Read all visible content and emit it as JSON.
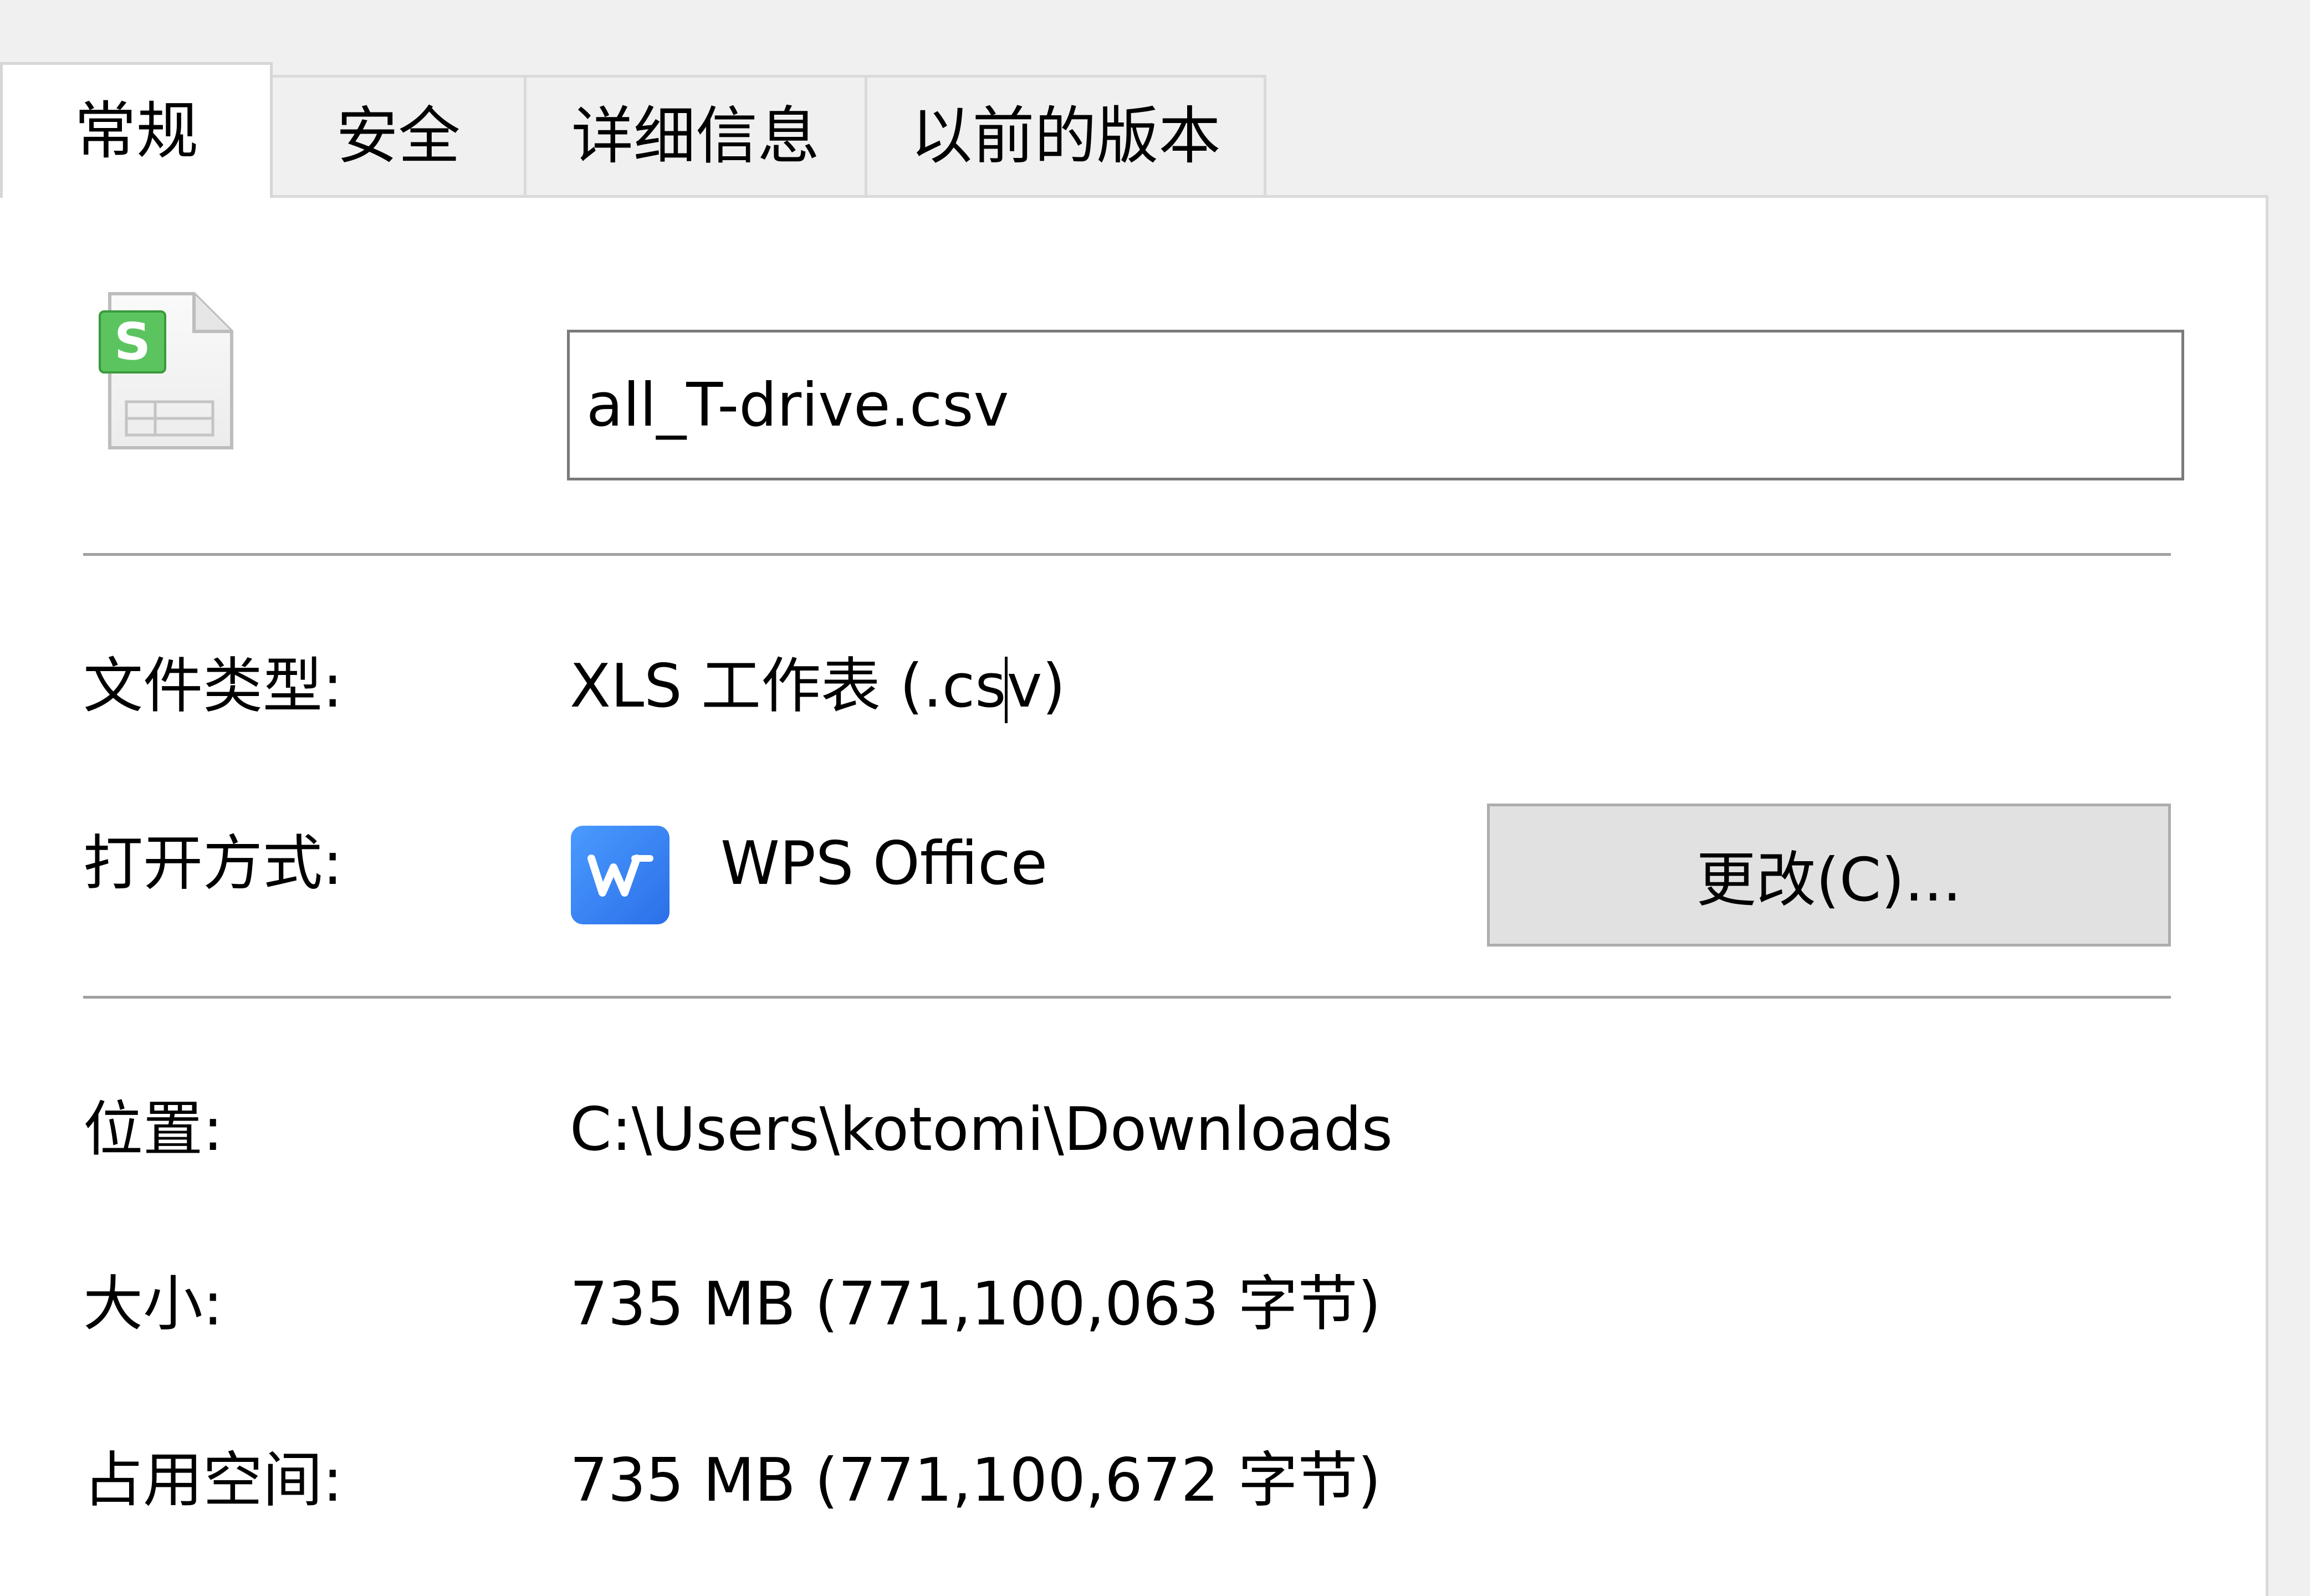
{
  "tabs": [
    {
      "label": "常规",
      "active": true
    },
    {
      "label": "安全",
      "active": false
    },
    {
      "label": "详细信息",
      "active": false
    },
    {
      "label": "以前的版本",
      "active": false
    }
  ],
  "file": {
    "icon": "spreadsheet-file-icon",
    "icon_letter": "S",
    "name": "all_T-drive.csv"
  },
  "fields": {
    "file_type_label": "文件类型:",
    "file_type_value_part1": "XLS 工作表 (.cs",
    "file_type_value_part2": "v)",
    "open_with_label": "打开方式:",
    "open_with_app": "WPS Office",
    "open_with_icon": "wps-office-icon",
    "change_button": "更改(C)...",
    "location_label": "位置:",
    "location_value": "C:\\Users\\kotomi\\Downloads",
    "size_label": "大小:",
    "size_value": "735 MB (771,100,063 字节)",
    "size_on_disk_label": "占用空间:",
    "size_on_disk_value": "735 MB (771,100,672 字节)"
  },
  "colors": {
    "window_bg": "#f0f0f0",
    "panel_bg": "#ffffff",
    "divider": "#a0a0a0",
    "button_bg": "#e1e1e1",
    "wps_blue": "#2b6fe8",
    "spreadsheet_green": "#4caf50"
  }
}
